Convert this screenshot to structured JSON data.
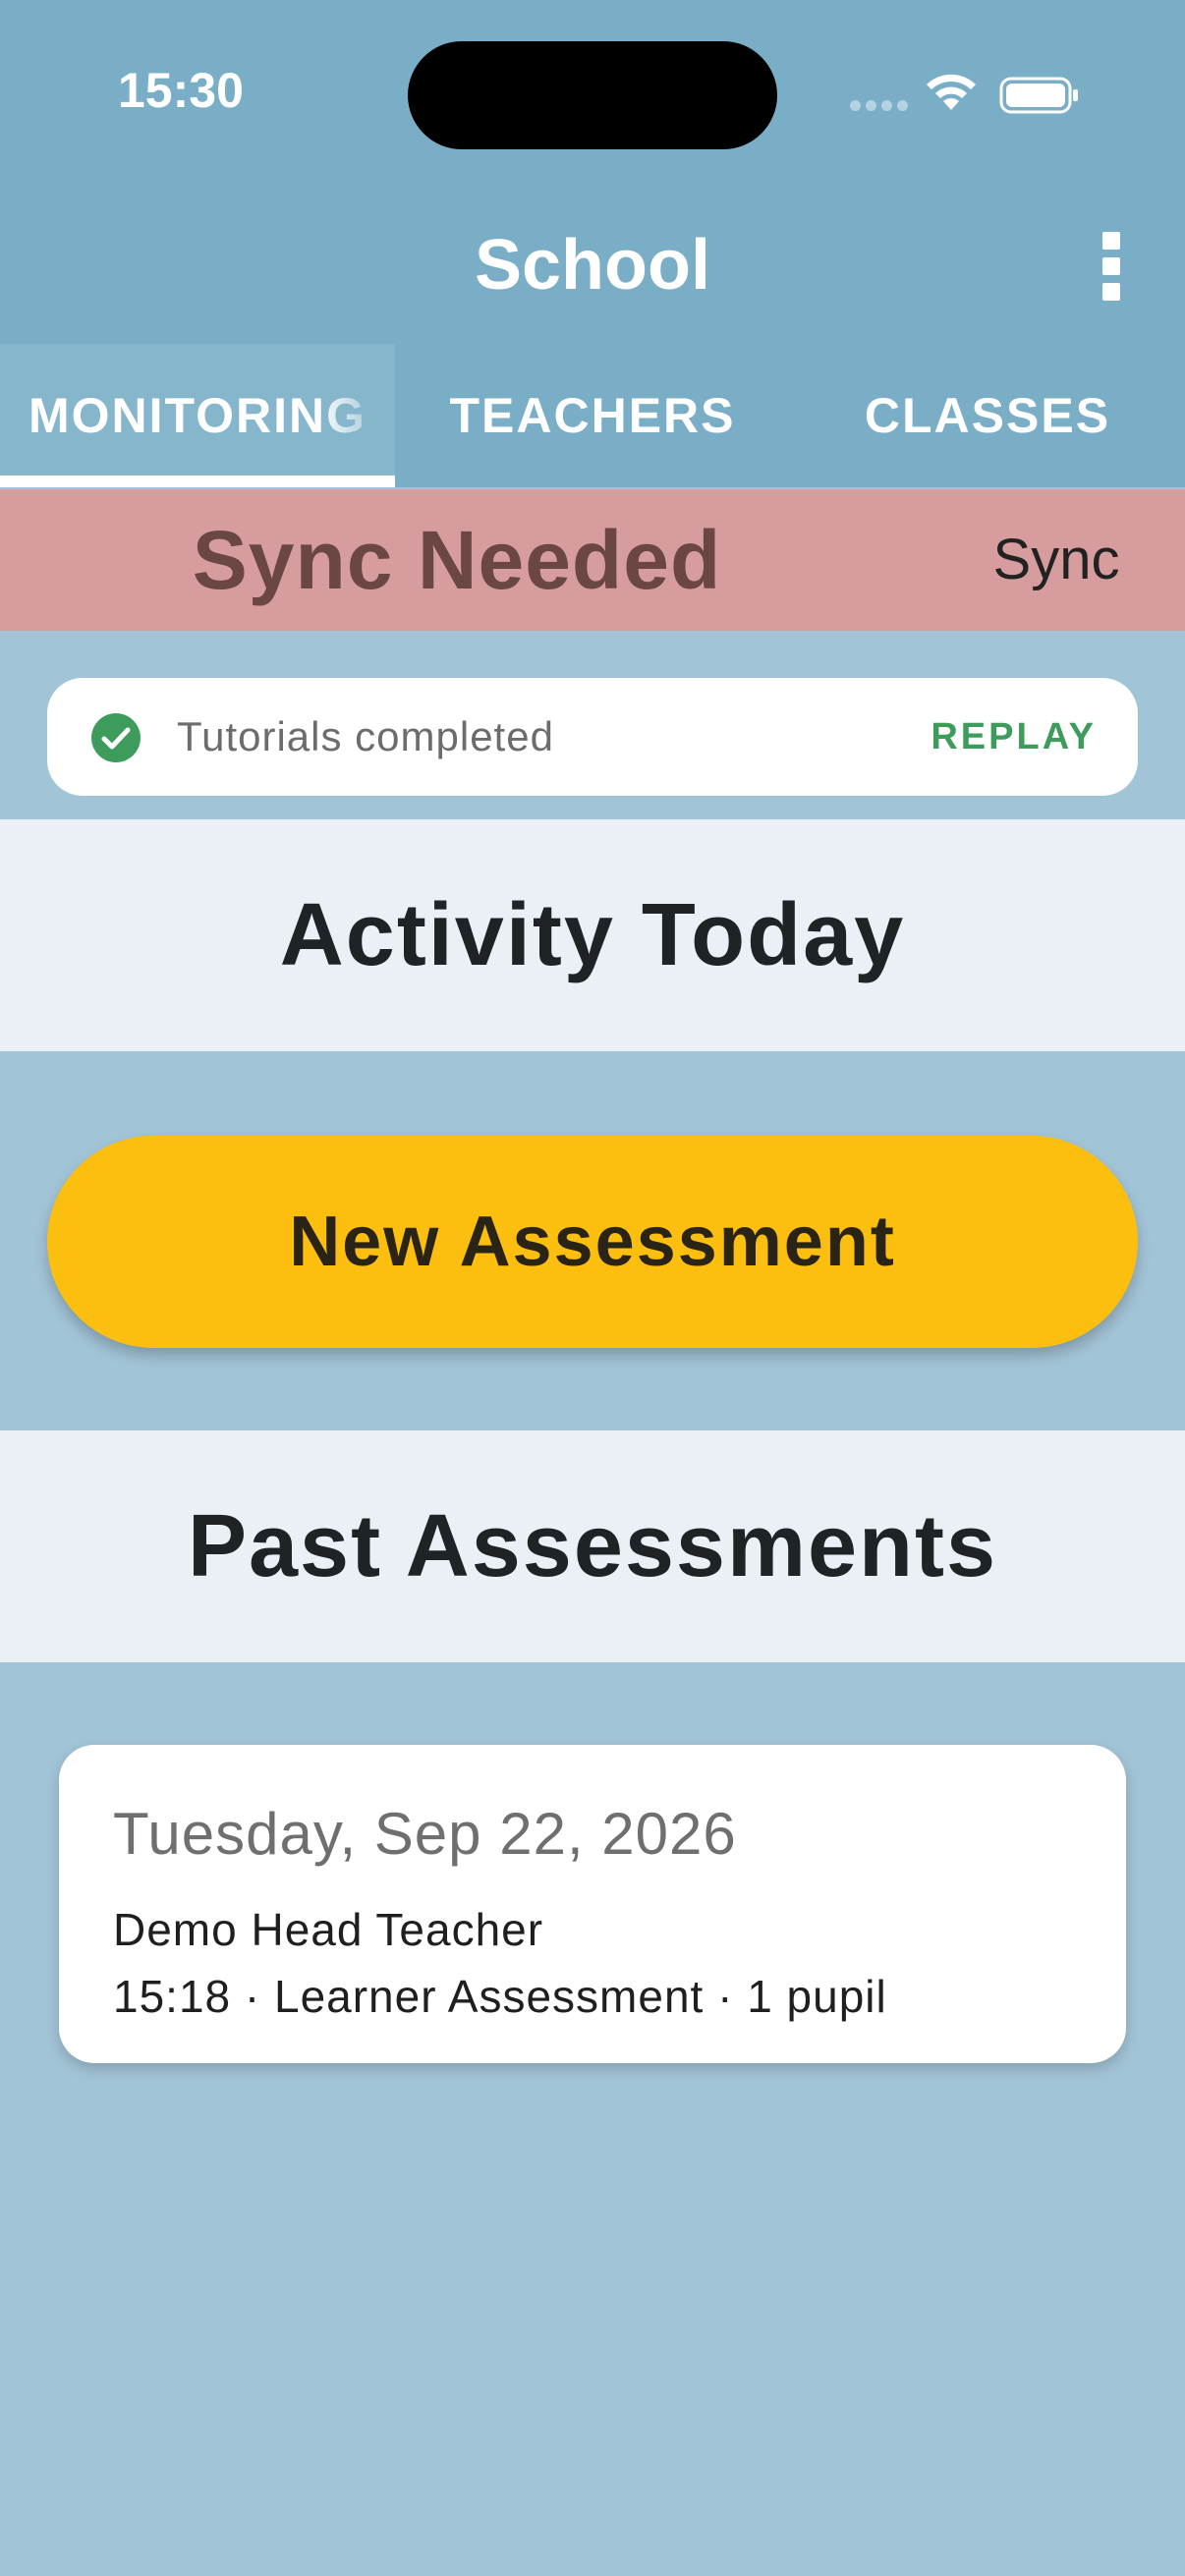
{
  "status_bar": {
    "time": "15:30",
    "icons": [
      "cellular-signal-icon",
      "wifi-icon",
      "battery-icon"
    ]
  },
  "app_bar": {
    "title": "School",
    "menu_icon": "more-vertical-icon"
  },
  "tabs": [
    {
      "label": "MONITORING",
      "active": true
    },
    {
      "label": "TEACHERS",
      "active": false
    },
    {
      "label": "CLASSES",
      "active": false
    }
  ],
  "sync_banner": {
    "title": "Sync Needed",
    "action": "Sync",
    "color": "#d79d9e"
  },
  "tutorial": {
    "icon": "check-circle-icon",
    "text": "Tutorials completed",
    "action": "REPLAY"
  },
  "activity": {
    "heading": "Activity Today",
    "button": "New Assessment",
    "button_color": "#fdbf0f"
  },
  "past": {
    "heading": "Past Assessments",
    "items": [
      {
        "date": "Tuesday, Sep 22, 2026",
        "teacher": "Demo Head Teacher",
        "detail": "15:18 · Learner Assessment · 1 pupil"
      }
    ]
  },
  "colors": {
    "header": "#7aaec6",
    "background": "#a2c4d7",
    "section": "#ebf0f6",
    "success": "#3d9b5c"
  }
}
